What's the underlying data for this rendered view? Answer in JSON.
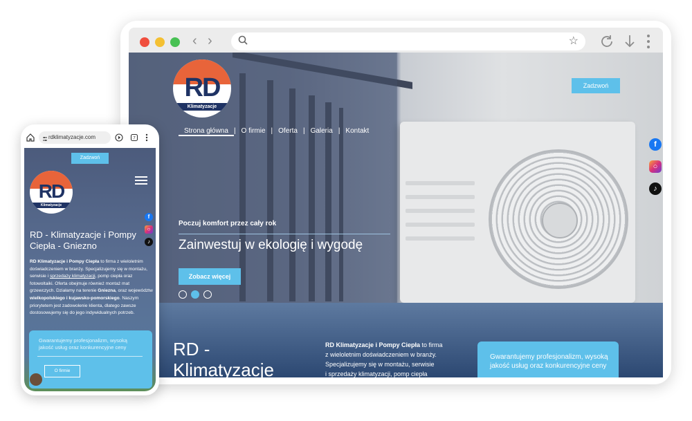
{
  "desktop": {
    "browser": {
      "back_icon": "chevron-left-icon",
      "forward_icon": "chevron-right-icon",
      "search_icon": "search-icon",
      "star_icon": "star-icon",
      "reload_icon": "reload-icon",
      "download_icon": "download-icon",
      "menu_icon": "more-vertical-icon",
      "address_value": ""
    },
    "logo": {
      "letters": "RD",
      "sub": "Klimatyzacje"
    },
    "nav": [
      {
        "label": "Strona główna"
      },
      {
        "label": "O firmie"
      },
      {
        "label": "Oferta"
      },
      {
        "label": "Galeria"
      },
      {
        "label": "Kontakt"
      }
    ],
    "call_button": "Zadzwoń",
    "hero": {
      "tag": "Poczuj komfort przez cały rok",
      "headline": "Zainwestuj w ekologię i wygodę",
      "cta": "Zobacz więcej"
    },
    "lower": {
      "title_line1": "RD -",
      "title_line2": "Klimatyzacje",
      "para_bold": "RD Klimatyzacje i Pompy Ciepła",
      "para_rest1": " to firma",
      "para_line2": "z wieloletnim doświadczeniem w branży.",
      "para_line3": "Specjalizujemy się w montażu, serwisie",
      "para_line4": "i sprzedaży klimatyzacji, pomp ciepła",
      "card": "Gwarantujemy profesjonalizm, wysoką jakość usług oraz konkurencyjne ceny"
    }
  },
  "mobile": {
    "url": "rdklimatyzacje.com",
    "call_button": "Zadzwoń",
    "logo": {
      "letters": "RD",
      "sub": "Klimatyzacje"
    },
    "title": "RD - Klimatyzacje i Pompy Ciepła - Gniezno",
    "text": {
      "b1": "RD Klimatyzacje i Pompy Ciepła",
      "t1": " to firma z wieloletnim doświadczeniem w branży. Specjalizujemy się w montażu, serwisie i ",
      "u1": "sprzedaży klimatyzacji",
      "t2": ", pomp ciepła oraz fotowoltaiki. Oferta obejmuje również montaż mat grzewczych. Działamy na terenie ",
      "b2": "Gniezna",
      "t3": ", oraz województw ",
      "b3": "wielkopolskiego i kujawsko-pomorskiego",
      "t4": ". Naszym priorytetem jest zadowolenie klienta, dlatego zawsze dostosowujemy się do jego indywidualnych potrzeb."
    },
    "card": "Gwarantujemy profesjonalizm, wysoką jakość usług oraz konkurencyjne ceny",
    "card_button": "O firmie"
  }
}
